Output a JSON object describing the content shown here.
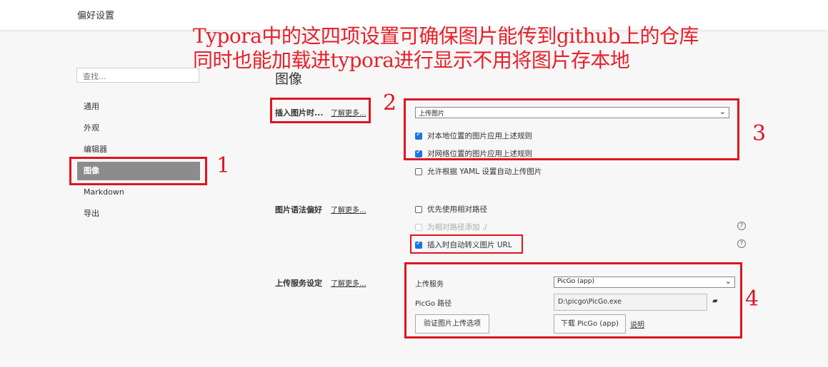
{
  "window": {
    "title": "偏好设置"
  },
  "annotation": {
    "line1": "Typora中的这四项设置可确保图片能传到github上的仓库",
    "line2": "同时也能加载进typora进行显示不用将图片存本地",
    "numbers": [
      "1",
      "2",
      "3",
      "4"
    ],
    "color": "#e0141e"
  },
  "sidebar": {
    "search_placeholder": "查找...",
    "items": [
      {
        "label": "通用"
      },
      {
        "label": "外观"
      },
      {
        "label": "编辑器"
      },
      {
        "label": "图像",
        "active": true
      },
      {
        "label": "Markdown"
      },
      {
        "label": "导出"
      }
    ]
  },
  "main": {
    "section_title": "图像",
    "learn_more": "了解更多...",
    "insert": {
      "label": "插入图片时...",
      "select_value": "上传图片",
      "options": [
        {
          "label": "对本地位置的图片应用上述规则",
          "checked": true
        },
        {
          "label": "对网络位置的图片应用上述规则",
          "checked": true
        },
        {
          "label": "允许根据 YAML 设置自动上传图片",
          "checked": false
        }
      ]
    },
    "syntax": {
      "label": "图片语法偏好",
      "options": [
        {
          "label": "优先使用相对路径",
          "checked": false
        },
        {
          "label": "为相对路径添加 ./",
          "checked": false,
          "disabled": true
        },
        {
          "label": "插入时自动转义图片 URL",
          "checked": true
        }
      ],
      "help": "?"
    },
    "upload": {
      "label": "上传服务设定",
      "service_label": "上传服务",
      "service_value": "PicGo (app)",
      "path_label": "PicGo 路径",
      "path_value": "D:\\picgo\\PicGo.exe",
      "verify_button": "验证图片上传选项",
      "download_button": "下载 PicGo (app)",
      "explain_link": "说明"
    }
  }
}
